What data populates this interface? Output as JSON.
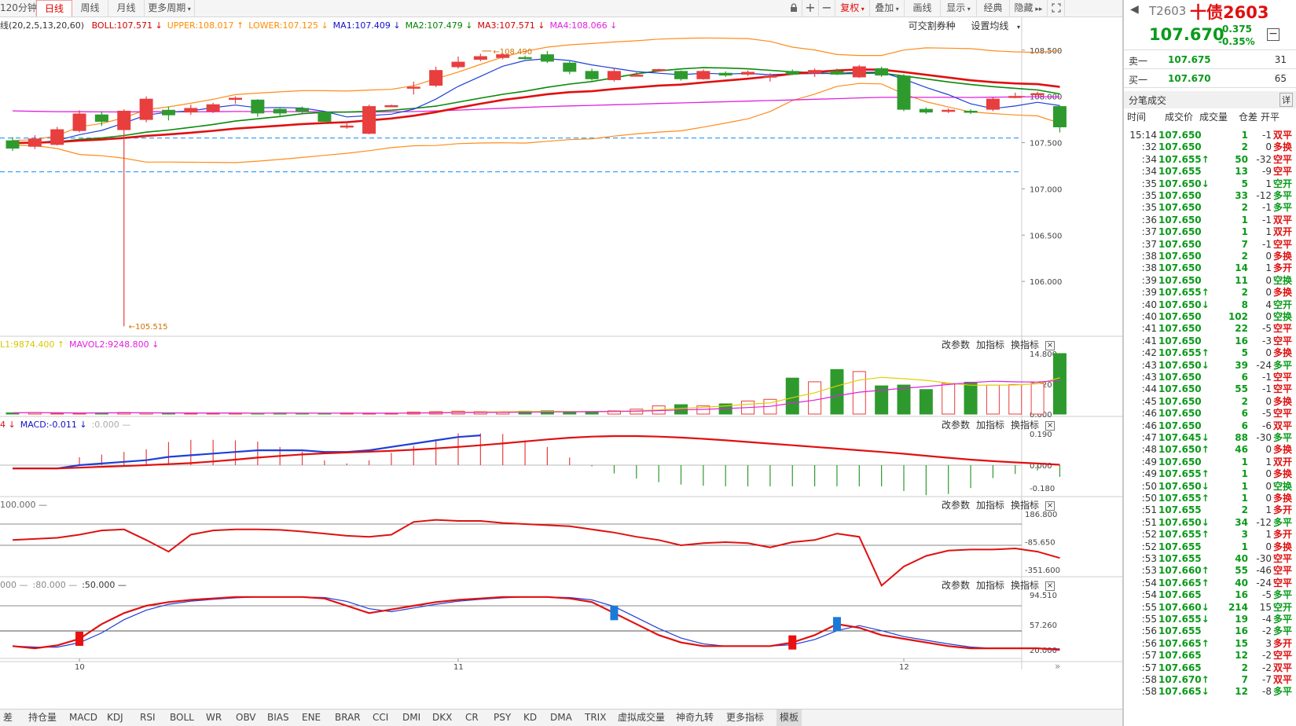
{
  "toolbar": {
    "left": [
      {
        "label": "120分钟",
        "active": false
      },
      {
        "label": "日线",
        "active": true
      },
      {
        "label": "周线",
        "active": false
      },
      {
        "label": "月线",
        "active": false
      },
      {
        "label": "更多周期",
        "active": false,
        "dropdown": true
      }
    ],
    "right": [
      {
        "label": "复权",
        "red": true,
        "dropdown": true
      },
      {
        "label": "叠加",
        "dropdown": true
      },
      {
        "label": "画线"
      },
      {
        "label": "显示",
        "dropdown": true
      },
      {
        "label": "经典"
      },
      {
        "label": "隐藏"
      }
    ]
  },
  "main_pane": {
    "legend": [
      {
        "text": "线(20,2,5,13,20,60)",
        "color": "#333333"
      },
      {
        "text": "BOLL:107.571",
        "color": "#d00000",
        "arrow": "↓"
      },
      {
        "text": "UPPER:108.017",
        "color": "#ff8c00",
        "arrow": "↑"
      },
      {
        "text": "LOWER:107.125",
        "color": "#ff8c00",
        "arrow": "↓"
      },
      {
        "text": "MA1:107.409",
        "color": "#1010c8",
        "arrow": "↓"
      },
      {
        "text": "MA2:107.479",
        "color": "#008000",
        "arrow": "↓"
      },
      {
        "text": "MA3:107.571",
        "color": "#d00000",
        "arrow": "↓"
      },
      {
        "text": "MA4:108.066",
        "color": "#e020e0",
        "arrow": "↓"
      }
    ],
    "tools": [
      "可交割券种",
      "设置均线"
    ],
    "y_ticks": [
      "108.500",
      "108.000",
      "107.500",
      "107.000",
      "106.500",
      "106.000"
    ],
    "annot_high": "108.490",
    "annot_low": "105.515"
  },
  "vol_pane": {
    "legend": [
      {
        "text": "L1:9874.400",
        "color": "#d8c800",
        "arrow": "↑"
      },
      {
        "text": "MAVOL2:9248.800",
        "color": "#e020e0",
        "arrow": "↓"
      }
    ],
    "y_ticks": [
      "14.800",
      "7.320",
      "0.000"
    ]
  },
  "macd_pane": {
    "legend": [
      {
        "text": "4",
        "color": "#e01010",
        "arrow": "↓"
      },
      {
        "text": "MACD:-0.011",
        "color": "#1010c8",
        "arrow": "↓"
      },
      {
        "text": ":0.000",
        "color": "#aaaaaa",
        "arrow": "—"
      }
    ],
    "y_ticks": [
      "0.190",
      "0.000",
      "-0.180"
    ]
  },
  "cci_pane": {
    "legend": [
      {
        "text": "100.000",
        "color": "#666666",
        "arrow": "—"
      }
    ],
    "y_ticks": [
      "186.800",
      "-85.650",
      "-351.600"
    ]
  },
  "kdj_pane": {
    "legend": [
      {
        "text": "000",
        "color": "#888888",
        "arrow": "—"
      },
      {
        "text": ":80.000",
        "color": "#888888",
        "arrow": "—"
      },
      {
        "text": ":50.000",
        "color": "#333333",
        "arrow": "—"
      }
    ],
    "y_ticks": [
      "94.510",
      "57.260",
      "20.000"
    ]
  },
  "pane_tools": [
    "改参数",
    "加指标",
    "换指标"
  ],
  "x_labels": [
    "10",
    "11",
    "12"
  ],
  "bottom_tabs": [
    "差",
    "持仓量",
    "MACD",
    "KDJ",
    "RSI",
    "BOLL",
    "WR",
    "OBV",
    "BIAS",
    "ENE",
    "BRAR",
    "CCI",
    "DMI",
    "DKX",
    "CR",
    "PSY",
    "KD",
    "DMA",
    "TRIX",
    "虚拟成交量",
    "神奇九转",
    "更多指标",
    "模板"
  ],
  "active_bottom_tab": "模板",
  "right_panel": {
    "code": "T2603",
    "name": "十债2603",
    "price": "107.670",
    "change": "-0.375",
    "change_pct": "-0.35%",
    "sell1_label": "卖一",
    "sell1_price": "107.675",
    "sell1_vol": "31",
    "buy1_label": "买一",
    "buy1_price": "107.670",
    "buy1_vol": "65",
    "trades_title": "分笔成交",
    "detail": "详",
    "headers": [
      "时间",
      "成交价",
      "成交量",
      "仓差",
      "开平"
    ],
    "trades": [
      {
        "t": "15:14",
        "p": "107.650",
        "a": "",
        "v": "1",
        "o": "-1",
        "n": "双平",
        "pc": "dn",
        "nc": "up"
      },
      {
        "t": ":32",
        "p": "107.650",
        "a": "",
        "v": "2",
        "o": "0",
        "n": "多换",
        "pc": "dn",
        "nc": "up"
      },
      {
        "t": ":34",
        "p": "107.655",
        "a": "↑",
        "v": "50",
        "o": "-32",
        "n": "空平",
        "pc": "dn",
        "nc": "up"
      },
      {
        "t": ":34",
        "p": "107.655",
        "a": "",
        "v": "13",
        "o": "-9",
        "n": "空平",
        "pc": "dn",
        "nc": "up"
      },
      {
        "t": ":35",
        "p": "107.650",
        "a": "↓",
        "v": "5",
        "o": "1",
        "n": "空开",
        "pc": "dn",
        "nc": "dn"
      },
      {
        "t": ":35",
        "p": "107.650",
        "a": "",
        "v": "33",
        "o": "-12",
        "n": "多平",
        "pc": "dn",
        "nc": "dn"
      },
      {
        "t": ":35",
        "p": "107.650",
        "a": "",
        "v": "2",
        "o": "-1",
        "n": "多平",
        "pc": "dn",
        "nc": "dn"
      },
      {
        "t": ":36",
        "p": "107.650",
        "a": "",
        "v": "1",
        "o": "-1",
        "n": "双平",
        "pc": "dn",
        "nc": "up"
      },
      {
        "t": ":37",
        "p": "107.650",
        "a": "",
        "v": "1",
        "o": "1",
        "n": "双开",
        "pc": "dn",
        "nc": "up"
      },
      {
        "t": ":37",
        "p": "107.650",
        "a": "",
        "v": "7",
        "o": "-1",
        "n": "空平",
        "pc": "dn",
        "nc": "up"
      },
      {
        "t": ":38",
        "p": "107.650",
        "a": "",
        "v": "2",
        "o": "0",
        "n": "多换",
        "pc": "dn",
        "nc": "up"
      },
      {
        "t": ":38",
        "p": "107.650",
        "a": "",
        "v": "14",
        "o": "1",
        "n": "多开",
        "pc": "dn",
        "nc": "up"
      },
      {
        "t": ":39",
        "p": "107.650",
        "a": "",
        "v": "11",
        "o": "0",
        "n": "空换",
        "pc": "dn",
        "nc": "dn"
      },
      {
        "t": ":39",
        "p": "107.655",
        "a": "↑",
        "v": "2",
        "o": "0",
        "n": "多换",
        "pc": "dn",
        "nc": "up"
      },
      {
        "t": ":40",
        "p": "107.650",
        "a": "↓",
        "v": "8",
        "o": "4",
        "n": "空开",
        "pc": "dn",
        "nc": "dn"
      },
      {
        "t": ":40",
        "p": "107.650",
        "a": "",
        "v": "102",
        "o": "0",
        "n": "空换",
        "pc": "dn",
        "nc": "dn"
      },
      {
        "t": ":41",
        "p": "107.650",
        "a": "",
        "v": "22",
        "o": "-5",
        "n": "空平",
        "pc": "dn",
        "nc": "up"
      },
      {
        "t": ":41",
        "p": "107.650",
        "a": "",
        "v": "16",
        "o": "-3",
        "n": "空平",
        "pc": "dn",
        "nc": "up"
      },
      {
        "t": ":42",
        "p": "107.655",
        "a": "↑",
        "v": "5",
        "o": "0",
        "n": "多换",
        "pc": "dn",
        "nc": "up"
      },
      {
        "t": ":43",
        "p": "107.650",
        "a": "↓",
        "v": "39",
        "o": "-24",
        "n": "多平",
        "pc": "dn",
        "nc": "dn"
      },
      {
        "t": ":43",
        "p": "107.650",
        "a": "",
        "v": "6",
        "o": "-1",
        "n": "空平",
        "pc": "dn",
        "nc": "up"
      },
      {
        "t": ":44",
        "p": "107.650",
        "a": "",
        "v": "55",
        "o": "-1",
        "n": "空平",
        "pc": "dn",
        "nc": "up"
      },
      {
        "t": ":45",
        "p": "107.650",
        "a": "",
        "v": "2",
        "o": "0",
        "n": "多换",
        "pc": "dn",
        "nc": "up"
      },
      {
        "t": ":46",
        "p": "107.650",
        "a": "",
        "v": "6",
        "o": "-5",
        "n": "空平",
        "pc": "dn",
        "nc": "up"
      },
      {
        "t": ":46",
        "p": "107.650",
        "a": "",
        "v": "6",
        "o": "-6",
        "n": "双平",
        "pc": "dn",
        "nc": "up"
      },
      {
        "t": ":47",
        "p": "107.645",
        "a": "↓",
        "v": "88",
        "o": "-30",
        "n": "多平",
        "pc": "dn",
        "nc": "dn"
      },
      {
        "t": ":48",
        "p": "107.650",
        "a": "↑",
        "v": "46",
        "o": "0",
        "n": "多换",
        "pc": "dn",
        "nc": "up"
      },
      {
        "t": ":49",
        "p": "107.650",
        "a": "",
        "v": "1",
        "o": "1",
        "n": "双开",
        "pc": "dn",
        "nc": "up"
      },
      {
        "t": ":49",
        "p": "107.655",
        "a": "↑",
        "v": "1",
        "o": "0",
        "n": "多换",
        "pc": "dn",
        "nc": "up"
      },
      {
        "t": ":50",
        "p": "107.650",
        "a": "↓",
        "v": "1",
        "o": "0",
        "n": "空换",
        "pc": "dn",
        "nc": "dn"
      },
      {
        "t": ":50",
        "p": "107.655",
        "a": "↑",
        "v": "1",
        "o": "0",
        "n": "多换",
        "pc": "dn",
        "nc": "up"
      },
      {
        "t": ":51",
        "p": "107.655",
        "a": "",
        "v": "2",
        "o": "1",
        "n": "多开",
        "pc": "dn",
        "nc": "up"
      },
      {
        "t": ":51",
        "p": "107.650",
        "a": "↓",
        "v": "34",
        "o": "-12",
        "n": "多平",
        "pc": "dn",
        "nc": "dn"
      },
      {
        "t": ":52",
        "p": "107.655",
        "a": "↑",
        "v": "3",
        "o": "1",
        "n": "多开",
        "pc": "dn",
        "nc": "up"
      },
      {
        "t": ":52",
        "p": "107.655",
        "a": "",
        "v": "1",
        "o": "0",
        "n": "多换",
        "pc": "dn",
        "nc": "up"
      },
      {
        "t": ":53",
        "p": "107.655",
        "a": "",
        "v": "40",
        "o": "-30",
        "n": "空平",
        "pc": "dn",
        "nc": "up"
      },
      {
        "t": ":53",
        "p": "107.660",
        "a": "↑",
        "v": "55",
        "o": "-46",
        "n": "空平",
        "pc": "dn",
        "nc": "up"
      },
      {
        "t": ":54",
        "p": "107.665",
        "a": "↑",
        "v": "40",
        "o": "-24",
        "n": "空平",
        "pc": "dn",
        "nc": "up"
      },
      {
        "t": ":54",
        "p": "107.665",
        "a": "",
        "v": "16",
        "o": "-5",
        "n": "多平",
        "pc": "dn",
        "nc": "dn"
      },
      {
        "t": ":55",
        "p": "107.660",
        "a": "↓",
        "v": "214",
        "o": "15",
        "n": "空开",
        "pc": "dn",
        "nc": "dn"
      },
      {
        "t": ":55",
        "p": "107.655",
        "a": "↓",
        "v": "19",
        "o": "-4",
        "n": "多平",
        "pc": "dn",
        "nc": "dn"
      },
      {
        "t": ":56",
        "p": "107.655",
        "a": "",
        "v": "16",
        "o": "-2",
        "n": "多平",
        "pc": "dn",
        "nc": "dn"
      },
      {
        "t": ":56",
        "p": "107.665",
        "a": "↑",
        "v": "15",
        "o": "3",
        "n": "多开",
        "pc": "dn",
        "nc": "up"
      },
      {
        "t": ":57",
        "p": "107.665",
        "a": "",
        "v": "12",
        "o": "-2",
        "n": "空平",
        "pc": "dn",
        "nc": "up"
      },
      {
        "t": ":57",
        "p": "107.665",
        "a": "",
        "v": "2",
        "o": "-2",
        "n": "双平",
        "pc": "dn",
        "nc": "up"
      },
      {
        "t": ":58",
        "p": "107.670",
        "a": "↑",
        "v": "7",
        "o": "-7",
        "n": "双平",
        "pc": "dn",
        "nc": "up"
      },
      {
        "t": ":58",
        "p": "107.665",
        "a": "↓",
        "v": "12",
        "o": "-8",
        "n": "多平",
        "pc": "dn",
        "nc": "dn"
      }
    ]
  },
  "colors": {
    "up_candle": "#e83e3e",
    "down_candle": "#2e9a2e",
    "boll_mid": "#e01010",
    "boll_band": "#ff8c1a",
    "ma1": "#1f3fd8",
    "ma2": "#0a8a0a",
    "ma4": "#e020e0",
    "dashed": "#3aa0ff"
  },
  "chart_data": [
    {
      "type": "candlestick",
      "pane": "price",
      "ylim": [
        105.5,
        108.6
      ],
      "candles": [
        [
          107.52,
          107.44,
          107.56,
          107.41
        ],
        [
          107.46,
          107.54,
          107.58,
          107.43
        ],
        [
          107.48,
          107.64,
          107.67,
          107.47
        ],
        [
          107.63,
          107.81,
          107.85,
          107.61
        ],
        [
          107.8,
          107.73,
          107.84,
          107.68
        ],
        [
          107.64,
          107.84,
          107.86,
          105.515
        ],
        [
          107.75,
          107.97,
          108.0,
          107.72
        ],
        [
          107.85,
          107.8,
          107.89,
          107.74
        ],
        [
          107.83,
          107.87,
          107.91,
          107.8
        ],
        [
          107.84,
          107.91,
          107.93,
          107.82
        ],
        [
          107.98,
          107.98,
          108.0,
          107.92
        ],
        [
          107.96,
          107.82,
          107.97,
          107.78
        ],
        [
          107.86,
          107.82,
          107.87,
          107.79
        ],
        [
          107.87,
          107.84,
          107.89,
          107.81
        ],
        [
          107.83,
          107.73,
          107.84,
          107.7
        ],
        [
          107.68,
          107.68,
          107.71,
          107.65
        ],
        [
          107.6,
          107.89,
          107.91,
          107.59
        ],
        [
          107.9,
          107.9,
          107.91,
          107.89
        ],
        [
          108.1,
          108.1,
          108.16,
          108.02
        ],
        [
          108.12,
          108.28,
          108.32,
          108.1
        ],
        [
          108.32,
          108.37,
          108.43,
          108.3
        ],
        [
          108.4,
          108.43,
          108.46,
          108.38
        ],
        [
          108.42,
          108.45,
          108.46,
          108.4
        ],
        [
          108.42,
          108.41,
          108.44,
          108.4
        ],
        [
          108.45,
          108.38,
          108.49,
          108.36
        ],
        [
          108.36,
          108.27,
          108.38,
          108.24
        ],
        [
          108.27,
          108.19,
          108.3,
          108.17
        ],
        [
          108.18,
          108.27,
          108.3,
          108.16
        ],
        [
          108.23,
          108.23,
          108.26,
          108.22
        ],
        [
          108.29,
          108.29,
          108.3,
          108.28
        ],
        [
          108.27,
          108.19,
          108.28,
          108.17
        ],
        [
          108.19,
          108.27,
          108.29,
          108.18
        ],
        [
          108.25,
          108.23,
          108.27,
          108.21
        ],
        [
          108.24,
          108.26,
          108.28,
          108.22
        ],
        [
          108.21,
          108.22,
          108.25,
          108.16
        ],
        [
          108.27,
          108.24,
          108.29,
          108.23
        ],
        [
          108.25,
          108.28,
          108.3,
          108.21
        ],
        [
          108.27,
          108.24,
          108.3,
          108.23
        ],
        [
          108.21,
          108.32,
          108.34,
          108.2
        ],
        [
          108.3,
          108.23,
          108.32,
          108.21
        ],
        [
          108.22,
          107.86,
          108.24,
          107.84
        ],
        [
          107.86,
          107.83,
          107.88,
          107.81
        ],
        [
          107.84,
          107.85,
          107.87,
          107.82
        ],
        [
          107.84,
          107.83,
          107.86,
          107.81
        ],
        [
          107.86,
          107.97,
          107.99,
          107.84
        ],
        [
          108.0,
          108.0,
          108.04,
          107.98
        ],
        [
          108.02,
          108.03,
          108.05,
          108.01
        ],
        [
          107.89,
          107.67,
          107.9,
          107.61
        ]
      ]
    },
    {
      "type": "bar",
      "pane": "volume",
      "values": [
        0.3,
        0.4,
        0.2,
        0.2,
        0.3,
        0.4,
        0.3,
        0.2,
        0.2,
        0.2,
        0.2,
        0.2,
        0.3,
        0.2,
        0.2,
        0.3,
        0.2,
        0.2,
        0.5,
        0.6,
        0.7,
        0.6,
        0.5,
        0.7,
        0.8,
        0.6,
        0.6,
        0.8,
        1.2,
        2.0,
        2.3,
        2.0,
        2.5,
        3.2,
        3.6,
        8.8,
        7.9,
        10.9,
        10.4,
        6.9,
        7.1,
        6.0,
        7.5,
        7.8,
        7.1,
        7.2,
        7.5,
        14.8
      ],
      "ylim": [
        0,
        14.8
      ]
    }
  ]
}
